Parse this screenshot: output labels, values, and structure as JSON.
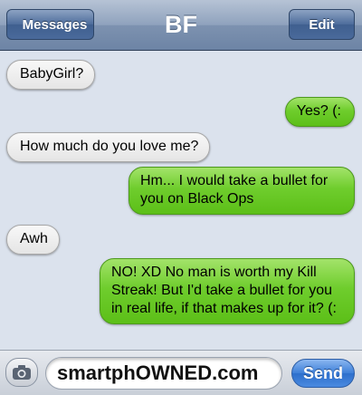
{
  "header": {
    "back_label": "Messages",
    "title": "BF",
    "edit_label": "Edit"
  },
  "messages": [
    {
      "from": "them",
      "text": "BabyGirl?"
    },
    {
      "from": "me",
      "text": "Yes? (:"
    },
    {
      "from": "them",
      "text": "How much do you love me?"
    },
    {
      "from": "me",
      "text": "Hm... I would take a bullet for you on Black Ops"
    },
    {
      "from": "them",
      "text": "Awh"
    },
    {
      "from": "me",
      "text": "NO! XD No man is worth my Kill Streak! But I'd take a bullet for you in real life, if that makes up for it? (:"
    }
  ],
  "composer": {
    "input_value": "smartphOWNED.com",
    "send_label": "Send"
  },
  "colors": {
    "sent_bubble": "#6fcd2d",
    "received_bubble": "#e5e5e5",
    "navbar": "#7d92b0",
    "background": "#dbe2ed",
    "send_button": "#3d7fd8"
  }
}
